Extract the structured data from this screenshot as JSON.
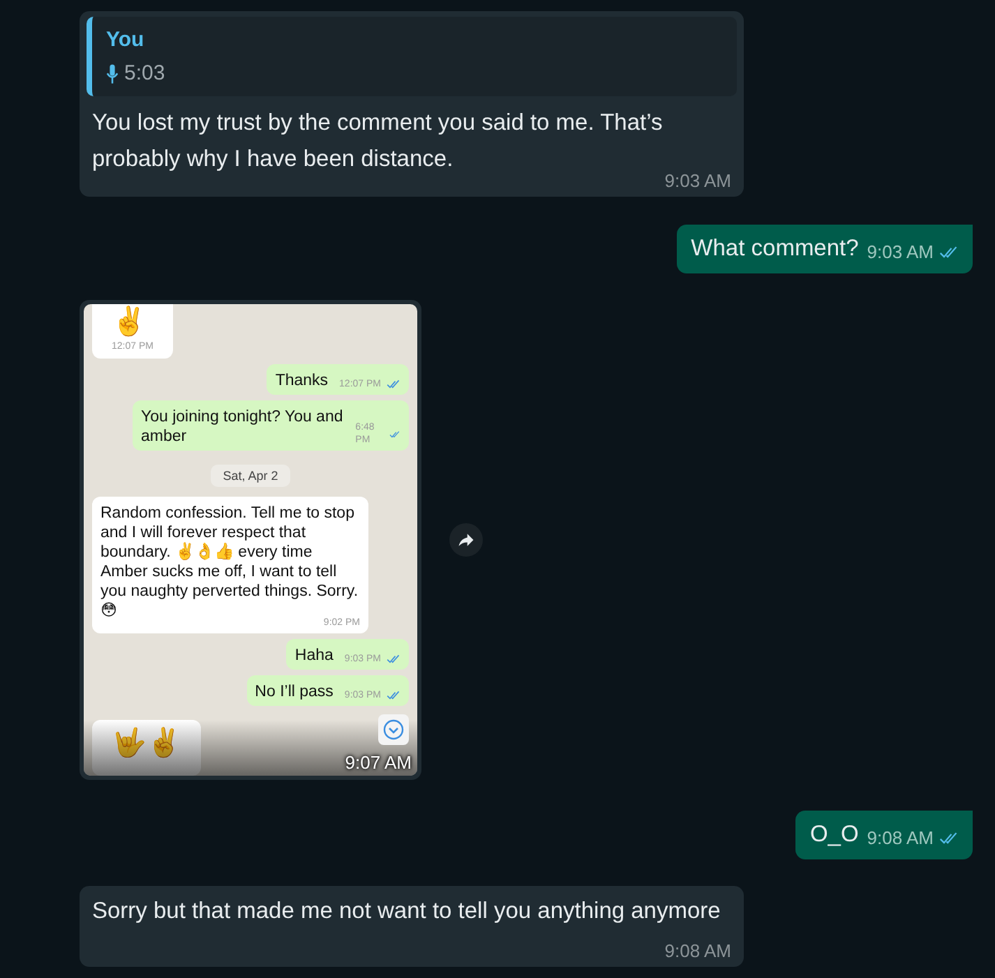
{
  "messages": [
    {
      "kind": "text",
      "outgoing": false,
      "quote": {
        "author": "You",
        "duration": "5:03"
      },
      "text": "You lost my trust by the comment you said to me. That’s probably why I have been distance.",
      "time": "9:03 AM"
    },
    {
      "kind": "text",
      "outgoing": true,
      "text": "What comment?",
      "time": "9:03 AM",
      "read": true
    },
    {
      "kind": "image",
      "outgoing": false,
      "time": "9:07 AM",
      "forward": true,
      "screenshot": [
        {
          "kind": "emoji",
          "outgoing": false,
          "text": "✌️",
          "time": "12:07 PM"
        },
        {
          "kind": "bubble",
          "outgoing": true,
          "text": "Thanks",
          "time": "12:07 PM",
          "read": true
        },
        {
          "kind": "bubble",
          "outgoing": true,
          "text": "You joining tonight? You and amber",
          "time": "6:48 PM",
          "read": true
        },
        {
          "kind": "date",
          "text": "Sat, Apr 2"
        },
        {
          "kind": "bubble",
          "outgoing": false,
          "text": "Random confession. Tell me to stop and I will forever respect that boundary. ✌️👌👍 every time Amber sucks me off, I want to tell you naughty perverted things. Sorry. 😳",
          "time": "9:02 PM"
        },
        {
          "kind": "bubble",
          "outgoing": true,
          "text": "Haha",
          "time": "9:03 PM",
          "read": true
        },
        {
          "kind": "bubble",
          "outgoing": true,
          "text": "No I’ll pass",
          "time": "9:03 PM",
          "read": true
        },
        {
          "kind": "emoji",
          "outgoing": false,
          "text": "🤟✌️"
        }
      ]
    },
    {
      "kind": "text",
      "outgoing": true,
      "text": "O_O",
      "time": "9:08 AM",
      "read": true
    },
    {
      "kind": "text",
      "outgoing": false,
      "text": "Sorry but that made me not want to tell you anything anymore",
      "time": "9:08 AM"
    }
  ]
}
